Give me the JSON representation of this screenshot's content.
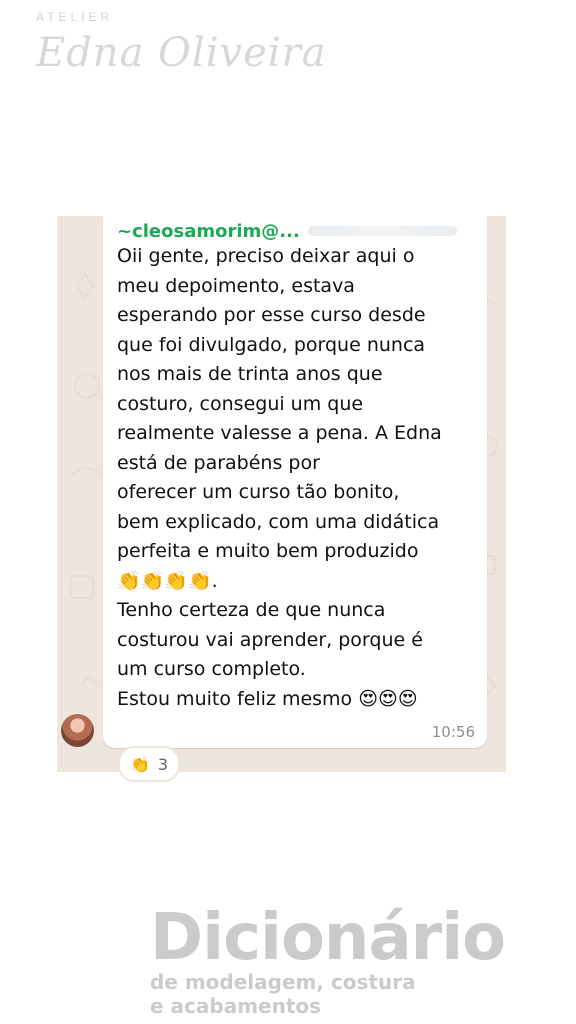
{
  "brand_top": {
    "small": "ATELIER",
    "script": "Edna Oliveira"
  },
  "chat": {
    "sender": "~cleosamorim@...",
    "message_lines": [
      "Oii gente,  preciso deixar aqui o",
      "meu depoimento, estava",
      "esperando por esse curso desde",
      "que foi divulgado, porque nunca",
      "nos mais de trinta anos que",
      "costuro, consegui um que",
      "realmente valesse a pena. A Edna",
      "está de parabéns por",
      " oferecer um curso tão bonito,",
      "bem explicado, com uma didática",
      "perfeita e muito bem produzido",
      "👏👏👏👏.",
      "Tenho certeza de que nunca",
      "costurou vai aprender, porque é",
      "um curso completo.",
      "Estou muito feliz mesmo 😍😍😍"
    ],
    "time": "10:56",
    "reaction": {
      "emoji": "👏",
      "count": "3"
    }
  },
  "brand_bottom": {
    "title": "Dicionário",
    "subtitle_1": "de modelagem, costura",
    "subtitle_2": "e acabamentos"
  },
  "colors": {
    "sender": "#1fa855",
    "chat_background": "#ece6dd",
    "bubble": "#ffffff",
    "time": "#8a8f93",
    "brand": "#cbcbcb"
  }
}
